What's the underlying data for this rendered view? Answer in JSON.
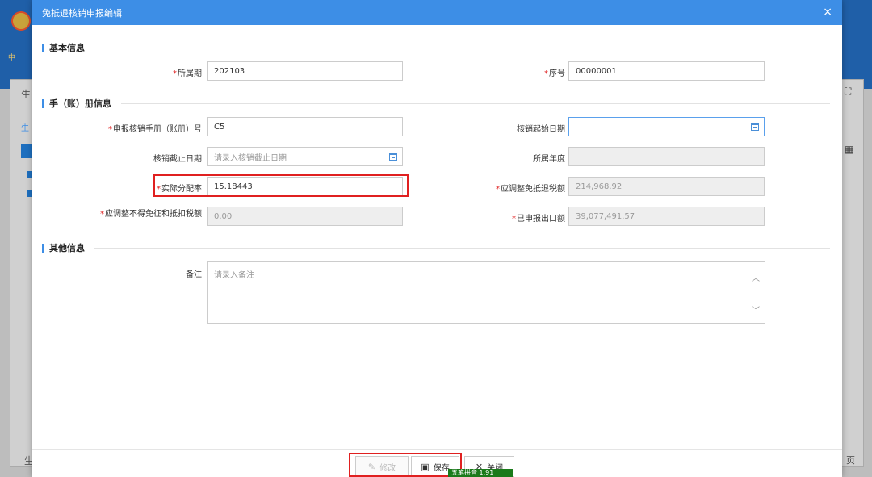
{
  "background": {
    "logo_text": "中",
    "side_label_1": "生",
    "side_label_2": "生",
    "side_label_3": "生",
    "right_label_page": "页"
  },
  "modal": {
    "title": "免抵退核销申报编辑",
    "close_icon": "×"
  },
  "sections": {
    "basic": "基本信息",
    "manual": "手（账）册信息",
    "other": "其他信息"
  },
  "fields": {
    "period": {
      "label": "所属期",
      "value": "202103"
    },
    "seq": {
      "label": "序号",
      "value": "00000001"
    },
    "manual_no": {
      "label": "申报核销手册（账册）号",
      "value": "C5"
    },
    "start_date": {
      "label": "核销起始日期",
      "value": ""
    },
    "end_date": {
      "label": "核销截止日期",
      "placeholder": "请录入核销截止日期"
    },
    "year": {
      "label": "所属年度",
      "value": ""
    },
    "ratio": {
      "label": "实际分配率",
      "value": "15.18443"
    },
    "adjust_tax": {
      "label": "应调整免抵退税额",
      "value": "214,968.92"
    },
    "adjust_nondeduct": {
      "label": "应调整不得免征和抵扣税额",
      "value": "0.00"
    },
    "declared_export": {
      "label": "已申报出口额",
      "value": "39,077,491.57"
    },
    "remark": {
      "label": "备注",
      "placeholder": "请录入备注"
    }
  },
  "buttons": {
    "modify": "修改",
    "save": "保存",
    "close": "关闭"
  },
  "overlay_badge": "五笔拼音  1.91",
  "colors": {
    "title_bar": "#3d8ee6",
    "required": "#e02020",
    "highlight": "#e02020"
  }
}
